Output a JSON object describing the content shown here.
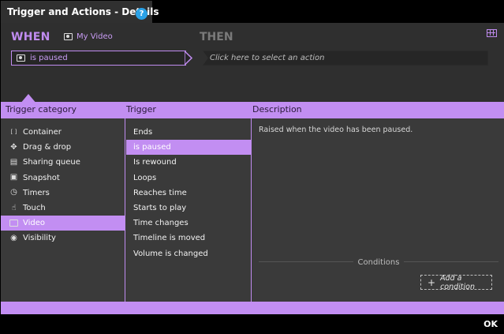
{
  "window": {
    "title": "Trigger and Actions - Details",
    "help_label": "?"
  },
  "when": {
    "label": "WHEN",
    "object_name": "My Video",
    "object_icon": "video-icon",
    "trigger_value": "is paused"
  },
  "then": {
    "label": "THEN",
    "action_placeholder": "Click here to select an action"
  },
  "headers": {
    "category": "Trigger category",
    "trigger": "Trigger",
    "description": "Description"
  },
  "categories": [
    {
      "label": "Container",
      "icon": "container-icon"
    },
    {
      "label": "Drag & drop",
      "icon": "drag-drop-icon"
    },
    {
      "label": "Sharing queue",
      "icon": "sharing-queue-icon"
    },
    {
      "label": "Snapshot",
      "icon": "snapshot-icon"
    },
    {
      "label": "Timers",
      "icon": "timer-icon"
    },
    {
      "label": "Touch",
      "icon": "touch-icon"
    },
    {
      "label": "Video",
      "icon": "video-icon"
    },
    {
      "label": "Visibility",
      "icon": "eye-icon"
    }
  ],
  "selected_category": "Video",
  "triggers": [
    "Ends",
    "is paused",
    "Is rewound",
    "Loops",
    "Reaches time",
    "Starts to play",
    "Time changes",
    "Timeline is moved",
    "Volume is changed"
  ],
  "selected_trigger": "is paused",
  "description": {
    "text": "Raised when the video has been paused.",
    "conditions_label": "Conditions",
    "add_condition_label": "Add a condition",
    "add_condition_icon": "plus-icon"
  },
  "footer": {
    "ok_label": "OK"
  },
  "colors": {
    "accent": "#c28ef2",
    "accent_text": "#c08cf0",
    "background": "#3a3a3a",
    "help": "#2aa1e6"
  }
}
